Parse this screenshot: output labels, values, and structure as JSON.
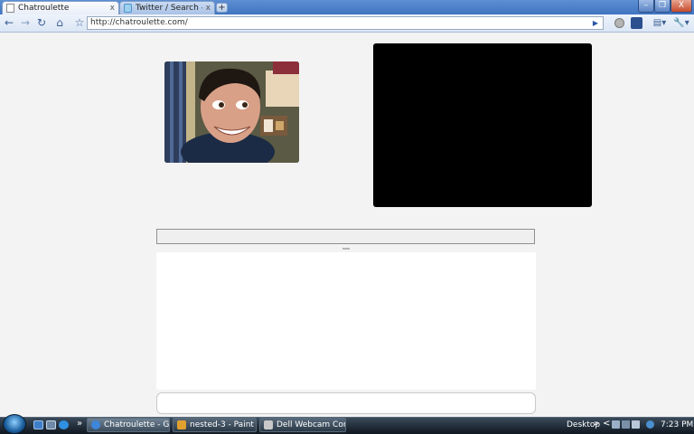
{
  "browser": {
    "tabs": [
      {
        "label": "Chatroulette",
        "active": true,
        "close_glyph": "x"
      },
      {
        "label": "Twitter / Search - Chatro...",
        "active": false,
        "close_glyph": "x"
      }
    ],
    "new_tab_glyph": "+",
    "window_buttons": {
      "minimize": "–",
      "maximize": "❐",
      "close": "X"
    },
    "toolbar": {
      "back": "←",
      "forward": "→",
      "reload": "↻",
      "home": "⌂",
      "star": "☆",
      "url": "http://chatroulette.com/",
      "go": "▶",
      "page_menu": "▤▾",
      "tools_menu": "🔧▾"
    }
  },
  "page": {
    "chat_input": {
      "value": "",
      "placeholder": ""
    }
  },
  "taskbar": {
    "chevron": "»",
    "tasks": [
      {
        "label": "Chatroulette - Goog...",
        "active": true,
        "icon_color": "#3d86d9"
      },
      {
        "label": "nested-3 - Paint",
        "active": false,
        "icon_color": "#e0a030"
      },
      {
        "label": "Dell Webcam Console",
        "active": false,
        "icon_color": "#c8c8c8"
      }
    ],
    "desktop_label": "Desktop",
    "tray_chevron": "»",
    "tray_arrow": "<",
    "clock": "7:23 PM"
  }
}
